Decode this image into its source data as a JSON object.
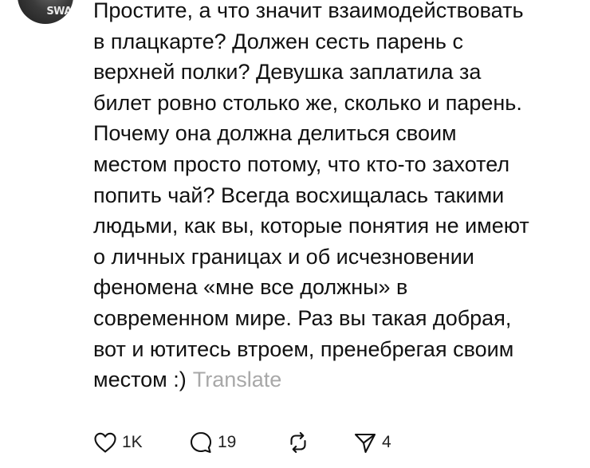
{
  "comment": {
    "text": "Простите, а что значит взаимодействовать\nв плацкарте? Должен сесть парень с\nверхней полки? Девушка заплатила за\nбилет ровно столько же, сколько и парень.\nПочему она должна делиться своим\nместом просто потому, что кто-то захотел\nпопить чай? Всегда восхищалась такими\nлюдьми, как вы, которые понятия не имеют\nо личных границах и об исчезновении\nфеномена «мне все должны» в\nсовременном мире. Раз вы такая добрая,\nвот и ютитесь втроем, пренебрегая своим\nместом :)",
    "translate_label": "Translate"
  },
  "avatar": {
    "text": "SWA"
  },
  "actions": {
    "like": {
      "icon": "heart-icon",
      "count": "1K"
    },
    "reply": {
      "icon": "speech-bubble-icon",
      "count": "19"
    },
    "repost": {
      "icon": "repost-icon"
    },
    "share": {
      "icon": "send-icon",
      "count": "4"
    }
  }
}
